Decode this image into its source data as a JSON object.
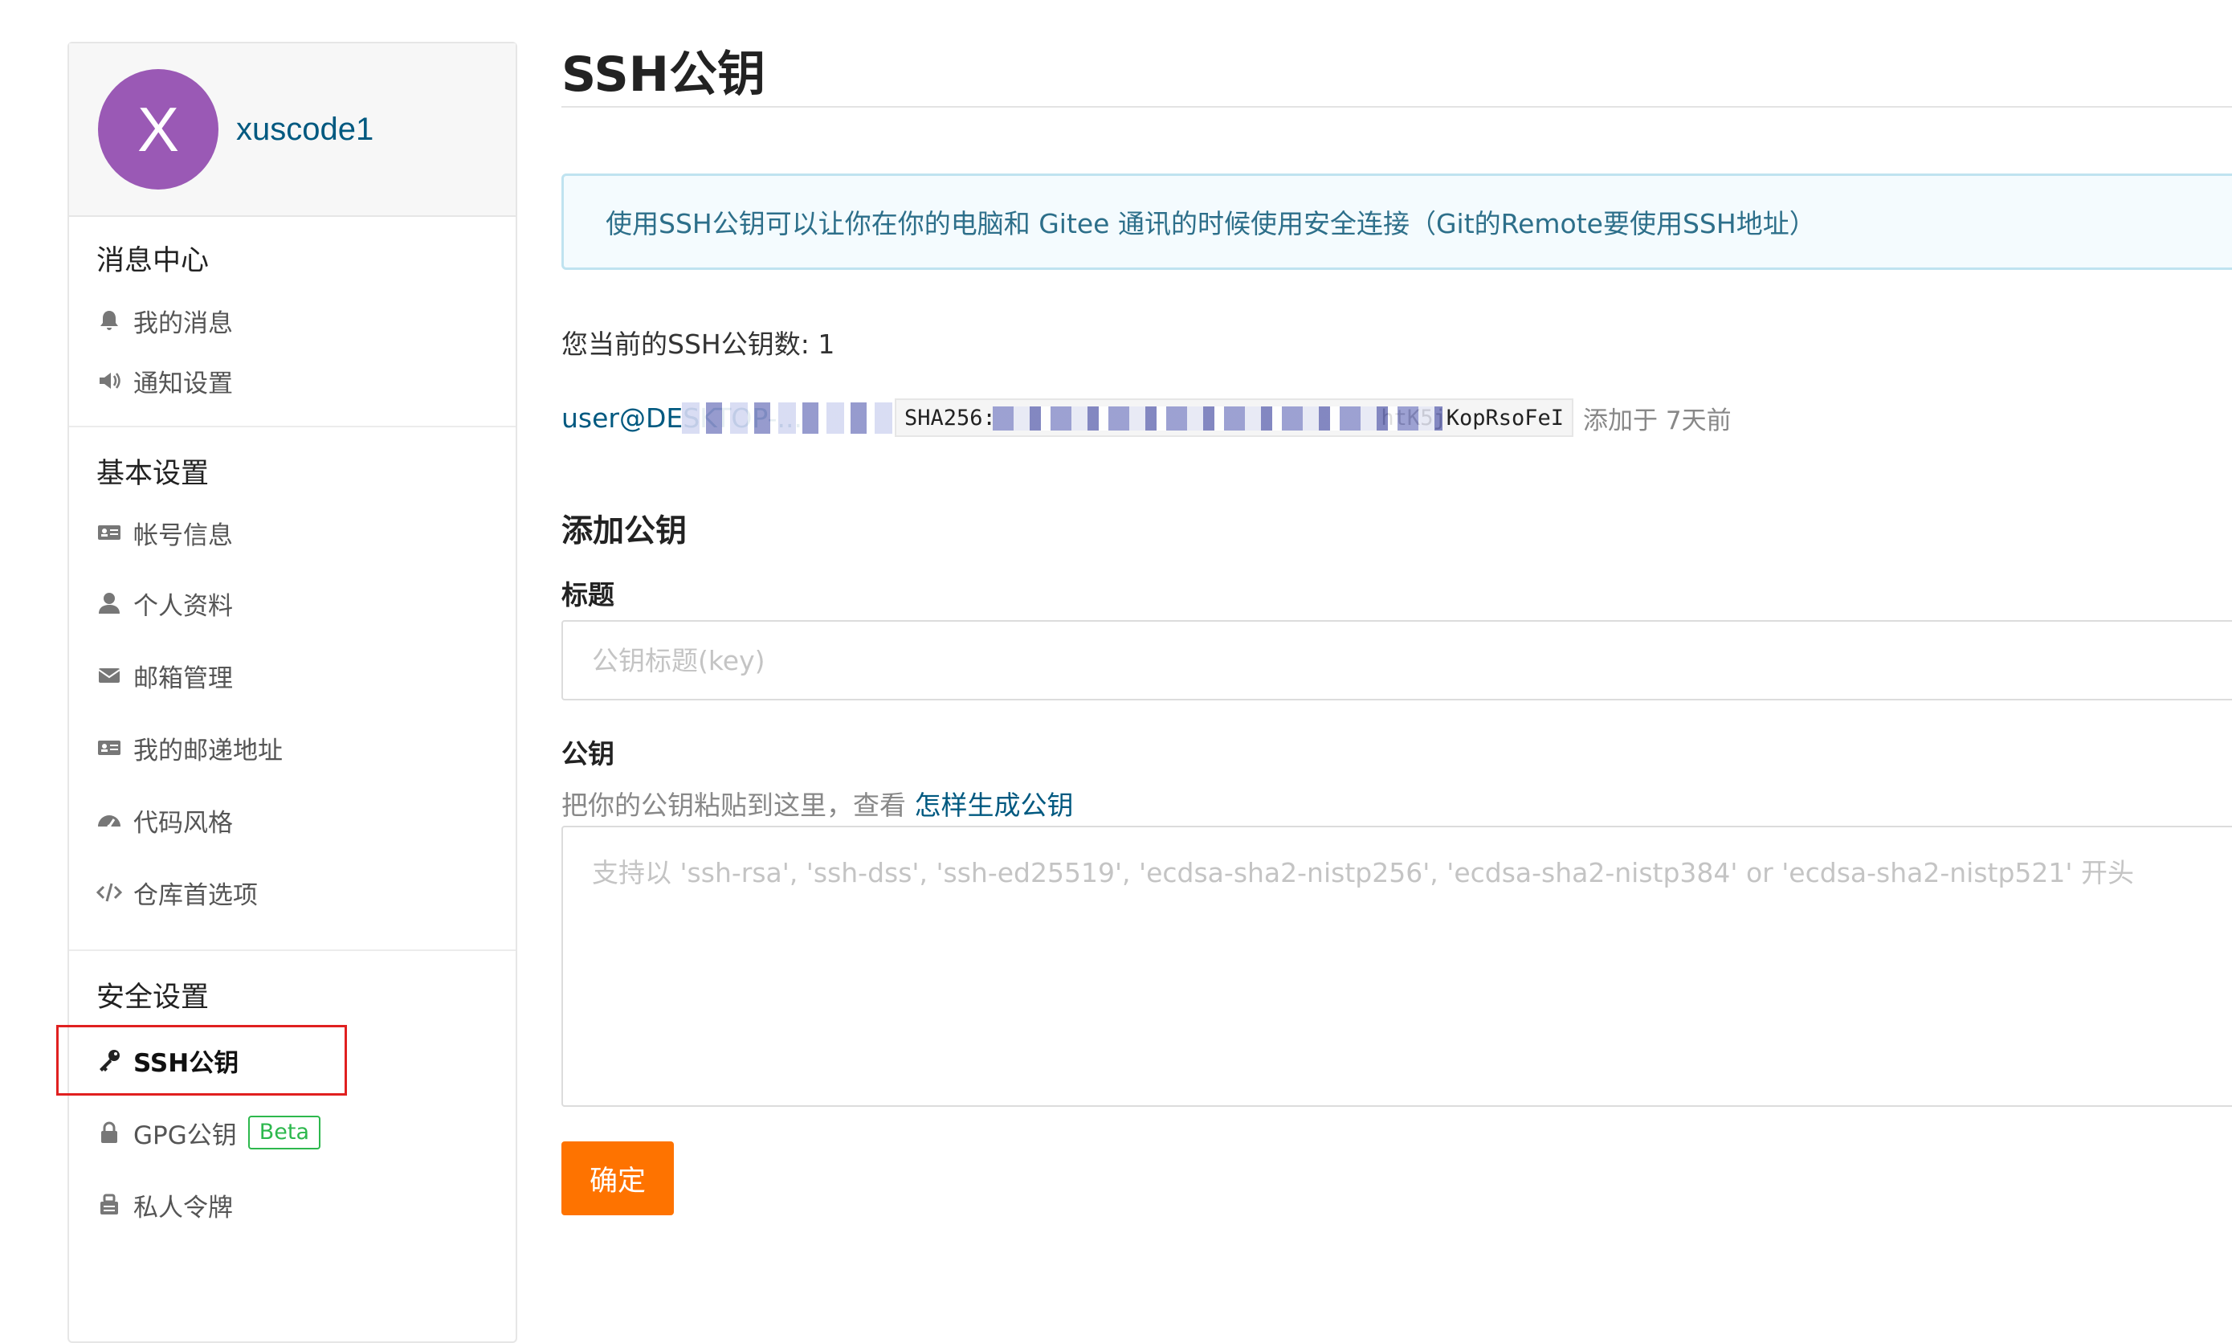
{
  "profile": {
    "avatar_letter": "X",
    "username": "xuscode1",
    "avatar_color": "#9a59b5"
  },
  "sidebar": {
    "groups": [
      {
        "title": "消息中心",
        "items": [
          {
            "label": "我的消息",
            "icon": "bell-icon"
          },
          {
            "label": "通知设置",
            "icon": "speaker-icon"
          }
        ]
      },
      {
        "title": "基本设置",
        "items": [
          {
            "label": "帐号信息",
            "icon": "id-card-icon"
          },
          {
            "label": "个人资料",
            "icon": "user-icon"
          },
          {
            "label": "邮箱管理",
            "icon": "envelope-icon"
          },
          {
            "label": "我的邮递地址",
            "icon": "address-card-icon"
          },
          {
            "label": "代码风格",
            "icon": "dashboard-icon"
          },
          {
            "label": "仓库首选项",
            "icon": "code-icon"
          }
        ]
      },
      {
        "title": "安全设置",
        "items": [
          {
            "label": "SSH公钥",
            "icon": "key-icon",
            "active": true
          },
          {
            "label": "GPG公钥",
            "icon": "lock-icon",
            "badge": "Beta"
          },
          {
            "label": "私人令牌",
            "icon": "token-icon"
          }
        ]
      }
    ]
  },
  "main": {
    "title": "SSH公钥",
    "info": "使用SSH公钥可以让你在你的电脑和 Gitee 通讯的时候使用安全连接（Git的Remote要使用SSH地址）",
    "key_count_text": "您当前的SSH公钥数: 1",
    "key": {
      "name": "user@DESKTOP-...",
      "fingerprint_prefix": "SHA256:",
      "fingerprint_suffix": "htK5jKopRsoFeI",
      "added": "添加于 7天前"
    },
    "add_section_title": "添加公钥",
    "title_label": "标题",
    "title_placeholder": "公钥标题(key)",
    "key_label": "公钥",
    "hint_text": "把你的公钥粘贴到这里，查看 ",
    "hint_link": "怎样生成公钥",
    "key_placeholder": "支持以 'ssh-rsa', 'ssh-dss', 'ssh-ed25519', 'ecdsa-sha2-nistp256', 'ecdsa-sha2-nistp384' or 'ecdsa-sha2-nistp521' 开头",
    "submit_label": "确定",
    "accent_color": "#fe7300",
    "highlight_color": "#e02020"
  }
}
